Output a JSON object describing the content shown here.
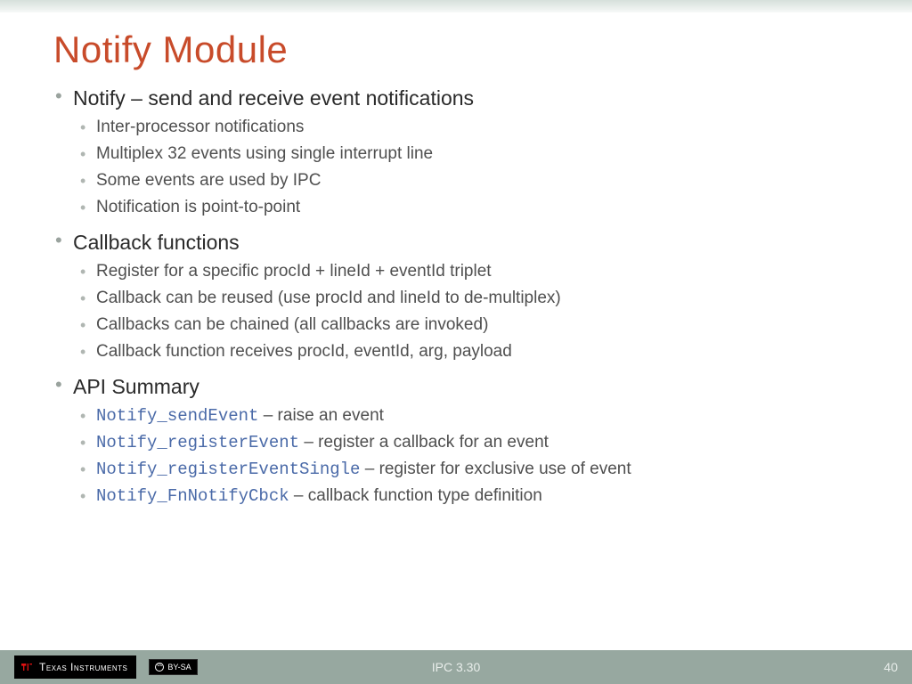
{
  "title": "Notify Module",
  "sections": [
    {
      "heading": "Notify – send and receive event notifications",
      "items": [
        "Inter-processor notifications",
        "Multiplex 32 events using single interrupt line",
        "Some events are used by IPC",
        "Notification is point-to-point"
      ]
    },
    {
      "heading": "Callback functions",
      "items": [
        "Register for a specific procId + lineId + eventId triplet",
        "Callback can be reused (use procId and lineId to de-multiplex)",
        "Callbacks can be chained (all callbacks are invoked)",
        "Callback function receives procId, eventId, arg, payload"
      ]
    },
    {
      "heading": "API Summary",
      "api": [
        {
          "fn": "Notify_sendEvent",
          "desc": " – raise an event"
        },
        {
          "fn": "Notify_registerEvent",
          "desc": " – register a callback for an event"
        },
        {
          "fn": "Notify_registerEventSingle",
          "desc": " – register for exclusive use of event"
        },
        {
          "fn": "Notify_FnNotifyCbck",
          "desc": " – callback function type definition"
        }
      ]
    }
  ],
  "footer": {
    "brand": "Texas Instruments",
    "license": "BY-SA",
    "center": "IPC 3.30",
    "page": "40"
  }
}
